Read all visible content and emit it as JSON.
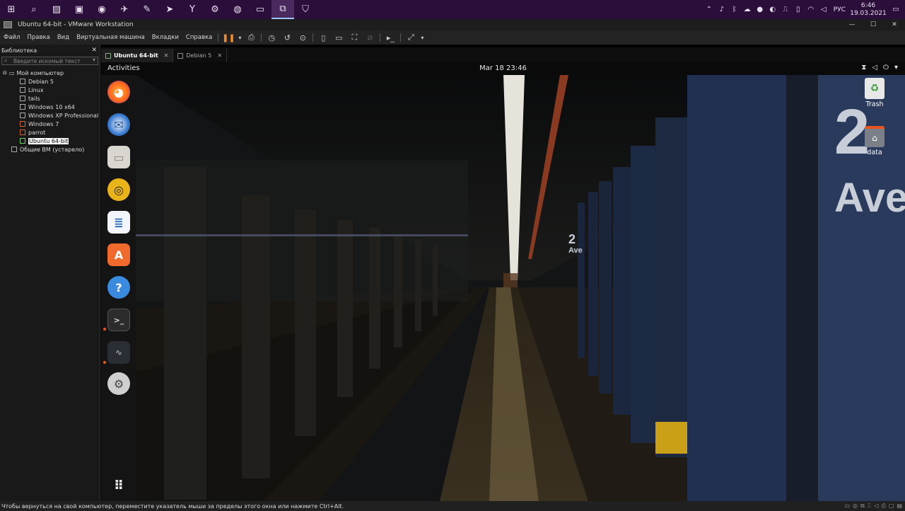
{
  "taskbar": {
    "apps": [
      {
        "name": "start-icon",
        "glyph": "⊞"
      },
      {
        "name": "search-icon",
        "glyph": "⌕"
      },
      {
        "name": "photo-editor-icon",
        "glyph": "▨"
      },
      {
        "name": "terminal-icon",
        "glyph": "▣"
      },
      {
        "name": "chrome-icon",
        "glyph": "◉"
      },
      {
        "name": "airplane-icon",
        "glyph": "✈"
      },
      {
        "name": "notes-icon",
        "glyph": "✎"
      },
      {
        "name": "telegram-icon",
        "glyph": "➤"
      },
      {
        "name": "yandex-browser-icon",
        "glyph": "Y"
      },
      {
        "name": "settings-gear-icon",
        "glyph": "⚙"
      },
      {
        "name": "messenger-icon",
        "glyph": "◍"
      },
      {
        "name": "file-explorer-icon",
        "glyph": "▭"
      },
      {
        "name": "vmware-icon",
        "glyph": "⧉"
      },
      {
        "name": "shield-icon",
        "glyph": "⛉"
      }
    ],
    "tray_icons": [
      "chevron-up-icon",
      "microphone-icon",
      "bluetooth-icon",
      "cloud-icon",
      "antivirus-icon",
      "discord-icon",
      "usb-icon",
      "phone-icon",
      "wifi-icon",
      "speaker-icon"
    ],
    "tray_glyphs": [
      "⌃",
      "♪",
      "ᛒ",
      "☁",
      "●",
      "◐",
      "⎍",
      "▯",
      "◠",
      "◁"
    ],
    "language": "РУС",
    "time": "6:46",
    "date": "19.03.2021"
  },
  "window": {
    "title": "Ubuntu 64-bit - VMware Workstation",
    "min": "—",
    "max": "☐",
    "close": "✕"
  },
  "menu": {
    "items": [
      "Файл",
      "Правка",
      "Вид",
      "Виртуальная машина",
      "Вкладки",
      "Справка"
    ]
  },
  "library": {
    "title": "Библиотека",
    "close": "✕",
    "search_placeholder": "Введите искомый текст",
    "root": "Мой компьютер",
    "vms": [
      "Debian 5",
      "Linux",
      "tails",
      "Windows 10 x64",
      "Windows XP Professional",
      "Windows 7",
      "parrot",
      "Ubuntu 64-bit"
    ],
    "shared": "Общие ВМ (устарело)"
  },
  "tabs": [
    {
      "label": "Ubuntu 64-bit",
      "close": "✕"
    },
    {
      "label": "Debian 5",
      "close": "✕"
    }
  ],
  "guest": {
    "activities": "Activities",
    "clock": "Mar 18  23:46",
    "desktop_icons": [
      {
        "label": "Trash"
      },
      {
        "label": "data"
      }
    ]
  },
  "wallpaper": {
    "station_sign_number": "2",
    "station_sign_text": "Ave",
    "small_sign_number": "2",
    "small_sign_text": "Ave"
  },
  "statusbar": {
    "text": "Чтобы вернуться на свой компьютер, переместите указатель мыши за пределы этого окна или нажмите Ctrl+Alt."
  }
}
